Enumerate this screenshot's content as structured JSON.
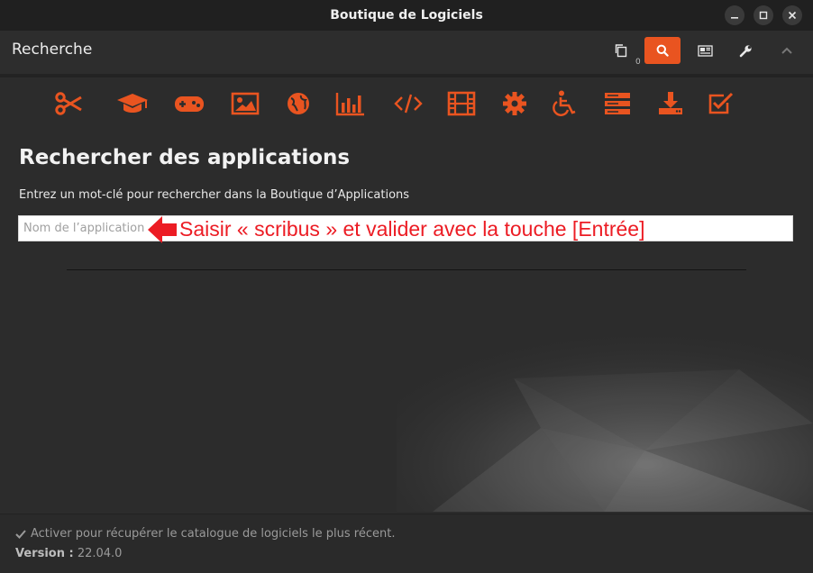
{
  "window": {
    "title": "Boutique de Logiciels"
  },
  "header": {
    "page_label": "Recherche",
    "cart_count": "0"
  },
  "categories": [
    "scissors-icon",
    "graduation-cap-icon",
    "gamepad-icon",
    "image-icon",
    "globe-icon",
    "bar-chart-icon",
    "code-icon",
    "film-icon",
    "gear-icon",
    "wheelchair-icon",
    "server-icon",
    "download-icon",
    "checkbox-icon"
  ],
  "main": {
    "heading": "Rechercher des applications",
    "subheading": "Entrez un mot-clé pour rechercher dans la Boutique d’Applications",
    "search_placeholder": "Nom de l’application",
    "annotation": "Saisir « scribus » et valider avec la touche [Entrée]"
  },
  "footer": {
    "status": "Activer pour récupérer le catalogue de logiciels le plus récent.",
    "version_label": "Version :",
    "version_value": "22.04.0"
  },
  "colors": {
    "accent": "#e95420",
    "annotation": "#ec1c24",
    "background": "#2c2c2c"
  }
}
